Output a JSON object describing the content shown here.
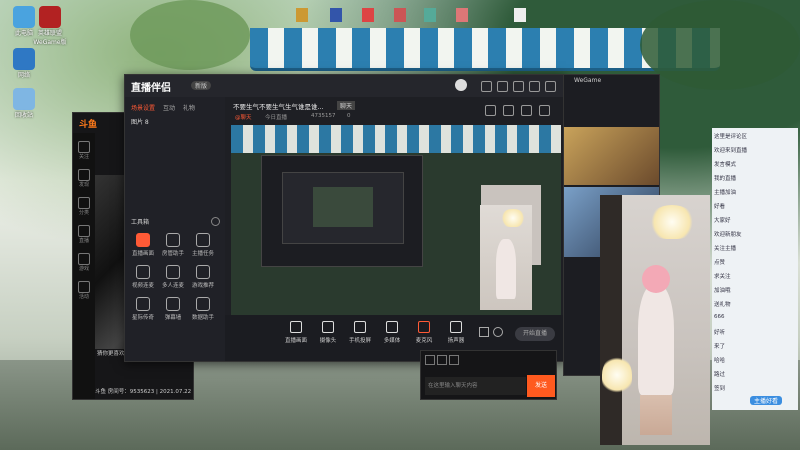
{
  "desktop_icons": [
    {
      "label": "此电脑",
      "icon": "computer-icon"
    },
    {
      "label": "英雄联盟 WeGame版",
      "icon": "game-icon"
    },
    {
      "label": "网络",
      "icon": "network-icon"
    },
    {
      "label": "回收站",
      "icon": "recycle-icon"
    }
  ],
  "main_window": {
    "app_name": "直播伴侣",
    "version_badge": "新版",
    "side_tabs": [
      "场景设置",
      "互动",
      "礼物"
    ],
    "active_side_tab": "场景设置",
    "scene_label": "图片 8",
    "tools_header": "工具箱",
    "tools": [
      {
        "label": "直播画面",
        "hot": true
      },
      {
        "label": "房管助手",
        "hot": false
      },
      {
        "label": "主播任务",
        "hot": false
      },
      {
        "label": "视频连麦",
        "hot": false
      },
      {
        "label": "多人连麦",
        "hot": false
      },
      {
        "label": "游戏推荐",
        "hot": false
      },
      {
        "label": "星际传奇",
        "hot": false
      },
      {
        "label": "弹幕墙",
        "hot": false
      },
      {
        "label": "数据助手",
        "hot": false
      }
    ],
    "stream_title": "不要生气不要生气生气谁是谁...",
    "stream_tag": "聊天",
    "stream_meta": [
      "@聊天",
      "今日直播",
      "4735157",
      "0"
    ],
    "bottom_buttons": [
      "直播画面",
      "摄像头",
      "手机投屏",
      "多媒体",
      "麦克风",
      "扬声器"
    ],
    "start_button": "开始直播"
  },
  "douyu_window": {
    "logo": "斗鱼",
    "nav": [
      "关注",
      "发现",
      "分类",
      "直播",
      "游戏",
      "活动",
      "关注"
    ],
    "room_info": "斗鱼 房间号：9535623 | 2021.07.22",
    "notice": "猜你更喜欢的直播间推荐...",
    "send_button": "发送",
    "chat_placeholder": "在这里输入聊天内容"
  },
  "wegame_window": {
    "title": "WeGame"
  },
  "chat_panel": {
    "lines": [
      "这里是评论区",
      "欢迎来到直播",
      "发言模式",
      "我的直播",
      "主播加油",
      "好看",
      "大家好",
      "欢迎新朋友",
      "关注主播",
      "点赞",
      "求关注",
      "加油哦",
      "送礼物",
      "666",
      "好听",
      "来了",
      "哈哈",
      "路过",
      "签到"
    ],
    "footer": "主播好看"
  },
  "colors": {
    "accent": "#ff5a36",
    "window_bg": "#1e1f24",
    "douyu_orange": "#ff5a1f"
  }
}
